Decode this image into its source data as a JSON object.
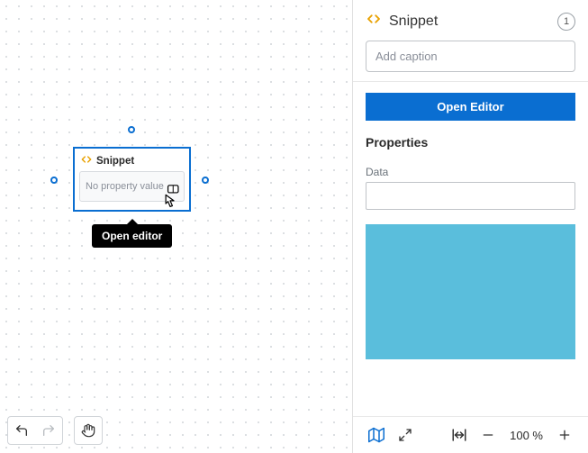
{
  "canvas": {
    "node": {
      "title": "Snippet",
      "body_placeholder": "No property value"
    },
    "tooltip": "Open editor"
  },
  "inspector": {
    "title": "Snippet",
    "count": "1",
    "caption_placeholder": "Add caption",
    "open_editor_label": "Open Editor",
    "properties_title": "Properties",
    "data_label": "Data",
    "zoom_label": "100 %"
  },
  "icons": {
    "snippet": "code-icon",
    "undo": "undo-icon",
    "redo": "redo-icon",
    "hand": "hand-icon",
    "map": "map-icon",
    "expand": "expand-icon",
    "fit_width": "fit-width-icon",
    "minus": "minus-icon",
    "plus": "plus-icon"
  }
}
